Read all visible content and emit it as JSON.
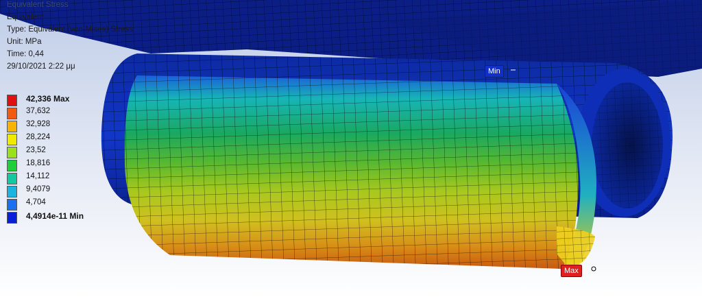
{
  "info": {
    "result_title": "Equivalent Stress",
    "name": "Equivalent",
    "type": "Type: Equivalent (von-Mises) Stress",
    "unit": "Unit: MPa",
    "time": "Time: 0,44",
    "date": "29/10/2021 2:22 μμ"
  },
  "legend": {
    "entries": [
      {
        "label": "42,336 Max",
        "color": "#e01010",
        "bold": true
      },
      {
        "label": "37,632",
        "color": "#f25a10"
      },
      {
        "label": "32,928",
        "color": "#f5b400"
      },
      {
        "label": "28,224",
        "color": "#f0ea00"
      },
      {
        "label": "23,52",
        "color": "#9be01a"
      },
      {
        "label": "18,816",
        "color": "#1fcf3a"
      },
      {
        "label": "14,112",
        "color": "#14c8a0"
      },
      {
        "label": "9,4079",
        "color": "#1ab4e0"
      },
      {
        "label": "4,704",
        "color": "#1a70f0"
      },
      {
        "label": "4,4914e-11 Min",
        "color": "#0a1fd8",
        "bold": true
      }
    ]
  },
  "probes": {
    "min_label": "Min",
    "max_label": "Max"
  },
  "colors": {
    "background_top": "#bfcde8",
    "plate": "#0a1f8a",
    "mesh_line": "#000000"
  }
}
